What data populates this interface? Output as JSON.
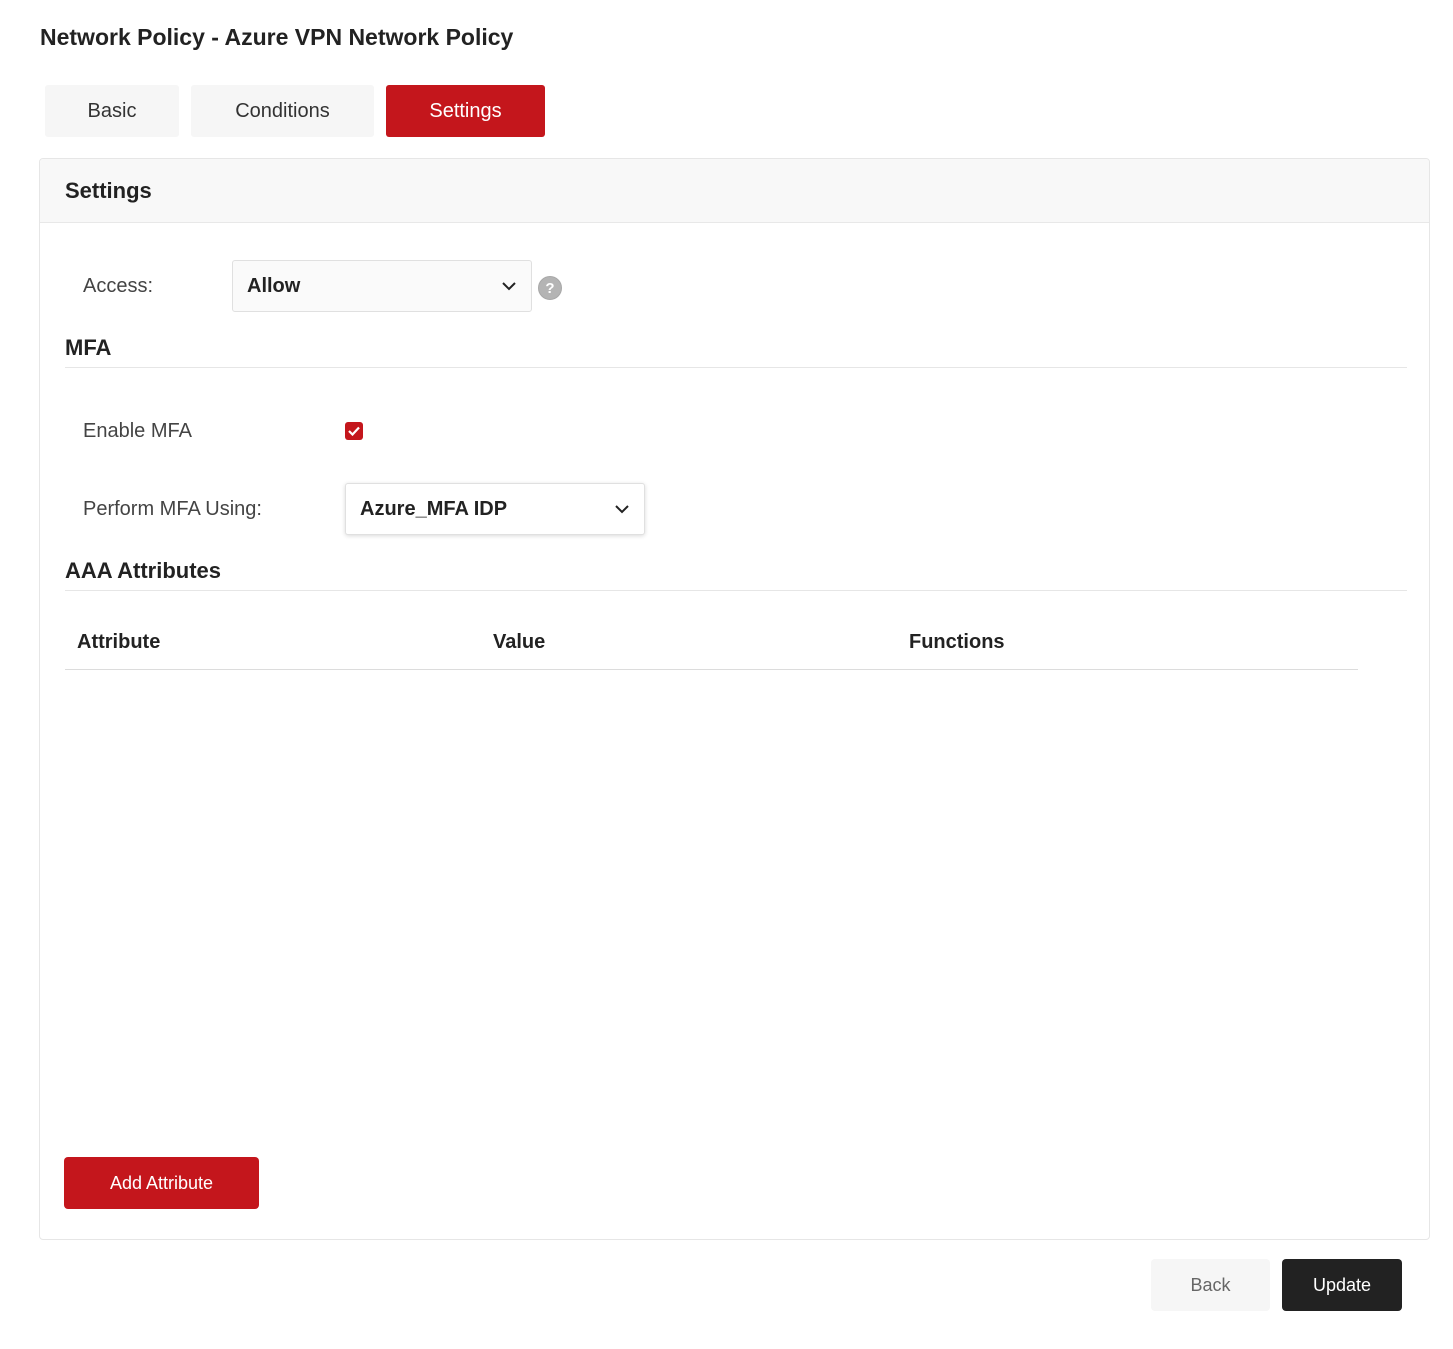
{
  "page": {
    "title": "Network Policy - Azure VPN Network Policy"
  },
  "tabs": [
    {
      "label": "Basic",
      "active": false
    },
    {
      "label": "Conditions",
      "active": false
    },
    {
      "label": "Settings",
      "active": true
    }
  ],
  "panel": {
    "title": "Settings"
  },
  "access": {
    "label": "Access:",
    "selected": "Allow",
    "help_icon": "question-circle-icon"
  },
  "mfa": {
    "title": "MFA",
    "enable_label": "Enable MFA",
    "enabled": true,
    "perform_label": "Perform MFA Using:",
    "selected": "Azure_MFA IDP"
  },
  "aaa": {
    "title": "AAA Attributes",
    "columns": [
      "Attribute",
      "Value",
      "Functions"
    ],
    "rows": [],
    "add_label": "Add Attribute"
  },
  "footer": {
    "back_label": "Back",
    "update_label": "Update"
  },
  "colors": {
    "accent": "#c4161c",
    "dark_button": "#222222",
    "light_button": "#f6f6f6"
  }
}
